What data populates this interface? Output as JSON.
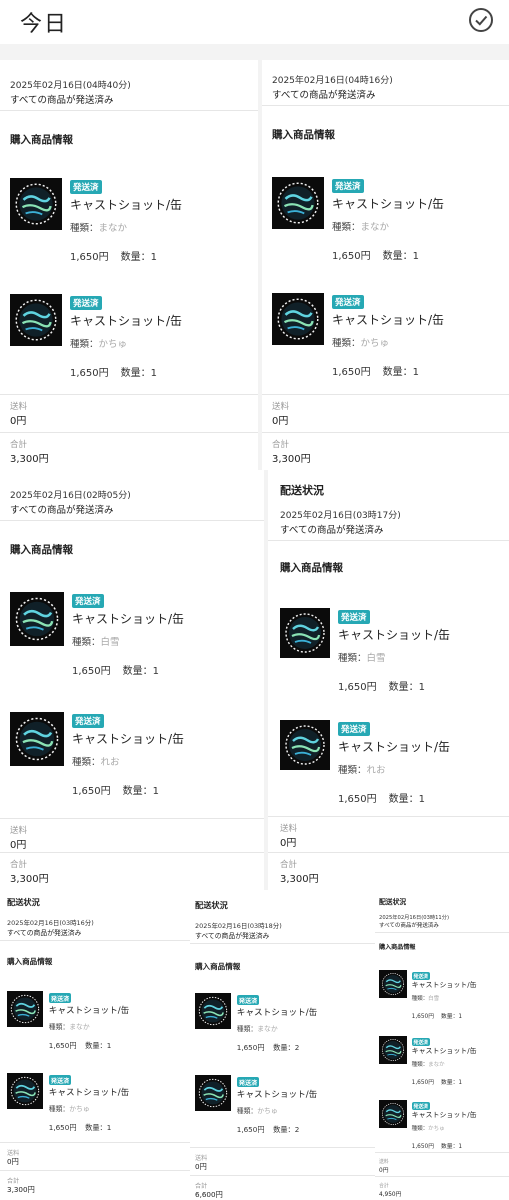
{
  "header": {
    "title": "今日"
  },
  "common": {
    "status": "すべての商品が発送済み",
    "purchase_label": "購入商品情報",
    "delivery_label": "配送状況",
    "badge": "発送済",
    "product": "キャストショット/缶",
    "variant_label": "種類：",
    "fee_label": "送料",
    "fee_value": "0円",
    "total_label": "合計"
  },
  "orders": [
    {
      "date": "2025年02月16日(04時40分)",
      "items": [
        {
          "variant": "まなか",
          "price": "1,650円",
          "qty": "数量：1"
        },
        {
          "variant": "かちゅ",
          "price": "1,650円",
          "qty": "数量：1"
        }
      ],
      "total": "3,300円"
    },
    {
      "date": "2025年02月16日(04時16分)",
      "items": [
        {
          "variant": "まなか",
          "price": "1,650円",
          "qty": "数量：1"
        },
        {
          "variant": "かちゅ",
          "price": "1,650円",
          "qty": "数量：1"
        }
      ],
      "total": "3,300円"
    },
    {
      "date": "2025年02月16日(02時05分)",
      "items": [
        {
          "variant": "白雪",
          "price": "1,650円",
          "qty": "数量：1"
        },
        {
          "variant": "れお",
          "price": "1,650円",
          "qty": "数量：1"
        }
      ],
      "total": "3,300円"
    },
    {
      "date": "2025年02月16日(03時17分)",
      "items": [
        {
          "variant": "白雪",
          "price": "1,650円",
          "qty": "数量：1"
        },
        {
          "variant": "れお",
          "price": "1,650円",
          "qty": "数量：1"
        }
      ],
      "total": "3,300円"
    },
    {
      "date": "2025年02月16日(03時16分)",
      "items": [
        {
          "variant": "まなか",
          "price": "1,650円",
          "qty": "数量：1"
        },
        {
          "variant": "かちゅ",
          "price": "1,650円",
          "qty": "数量：1"
        }
      ],
      "total": "3,300円"
    },
    {
      "date": "2025年02月16日(03時18分)",
      "items": [
        {
          "variant": "まなか",
          "price": "1,650円",
          "qty": "数量：2"
        },
        {
          "variant": "かちゅ",
          "price": "1,650円",
          "qty": "数量：2"
        }
      ],
      "total": "6,600円"
    },
    {
      "date": "2025年02月16日(03時11分)",
      "items": [
        {
          "variant": "白雪",
          "price": "1,650円",
          "qty": "数量：1"
        },
        {
          "variant": "まなか",
          "price": "1,650円",
          "qty": "数量：1"
        },
        {
          "variant": "かちゅ",
          "price": "1,650円",
          "qty": "数量：1"
        }
      ],
      "total": "4,950円"
    }
  ]
}
